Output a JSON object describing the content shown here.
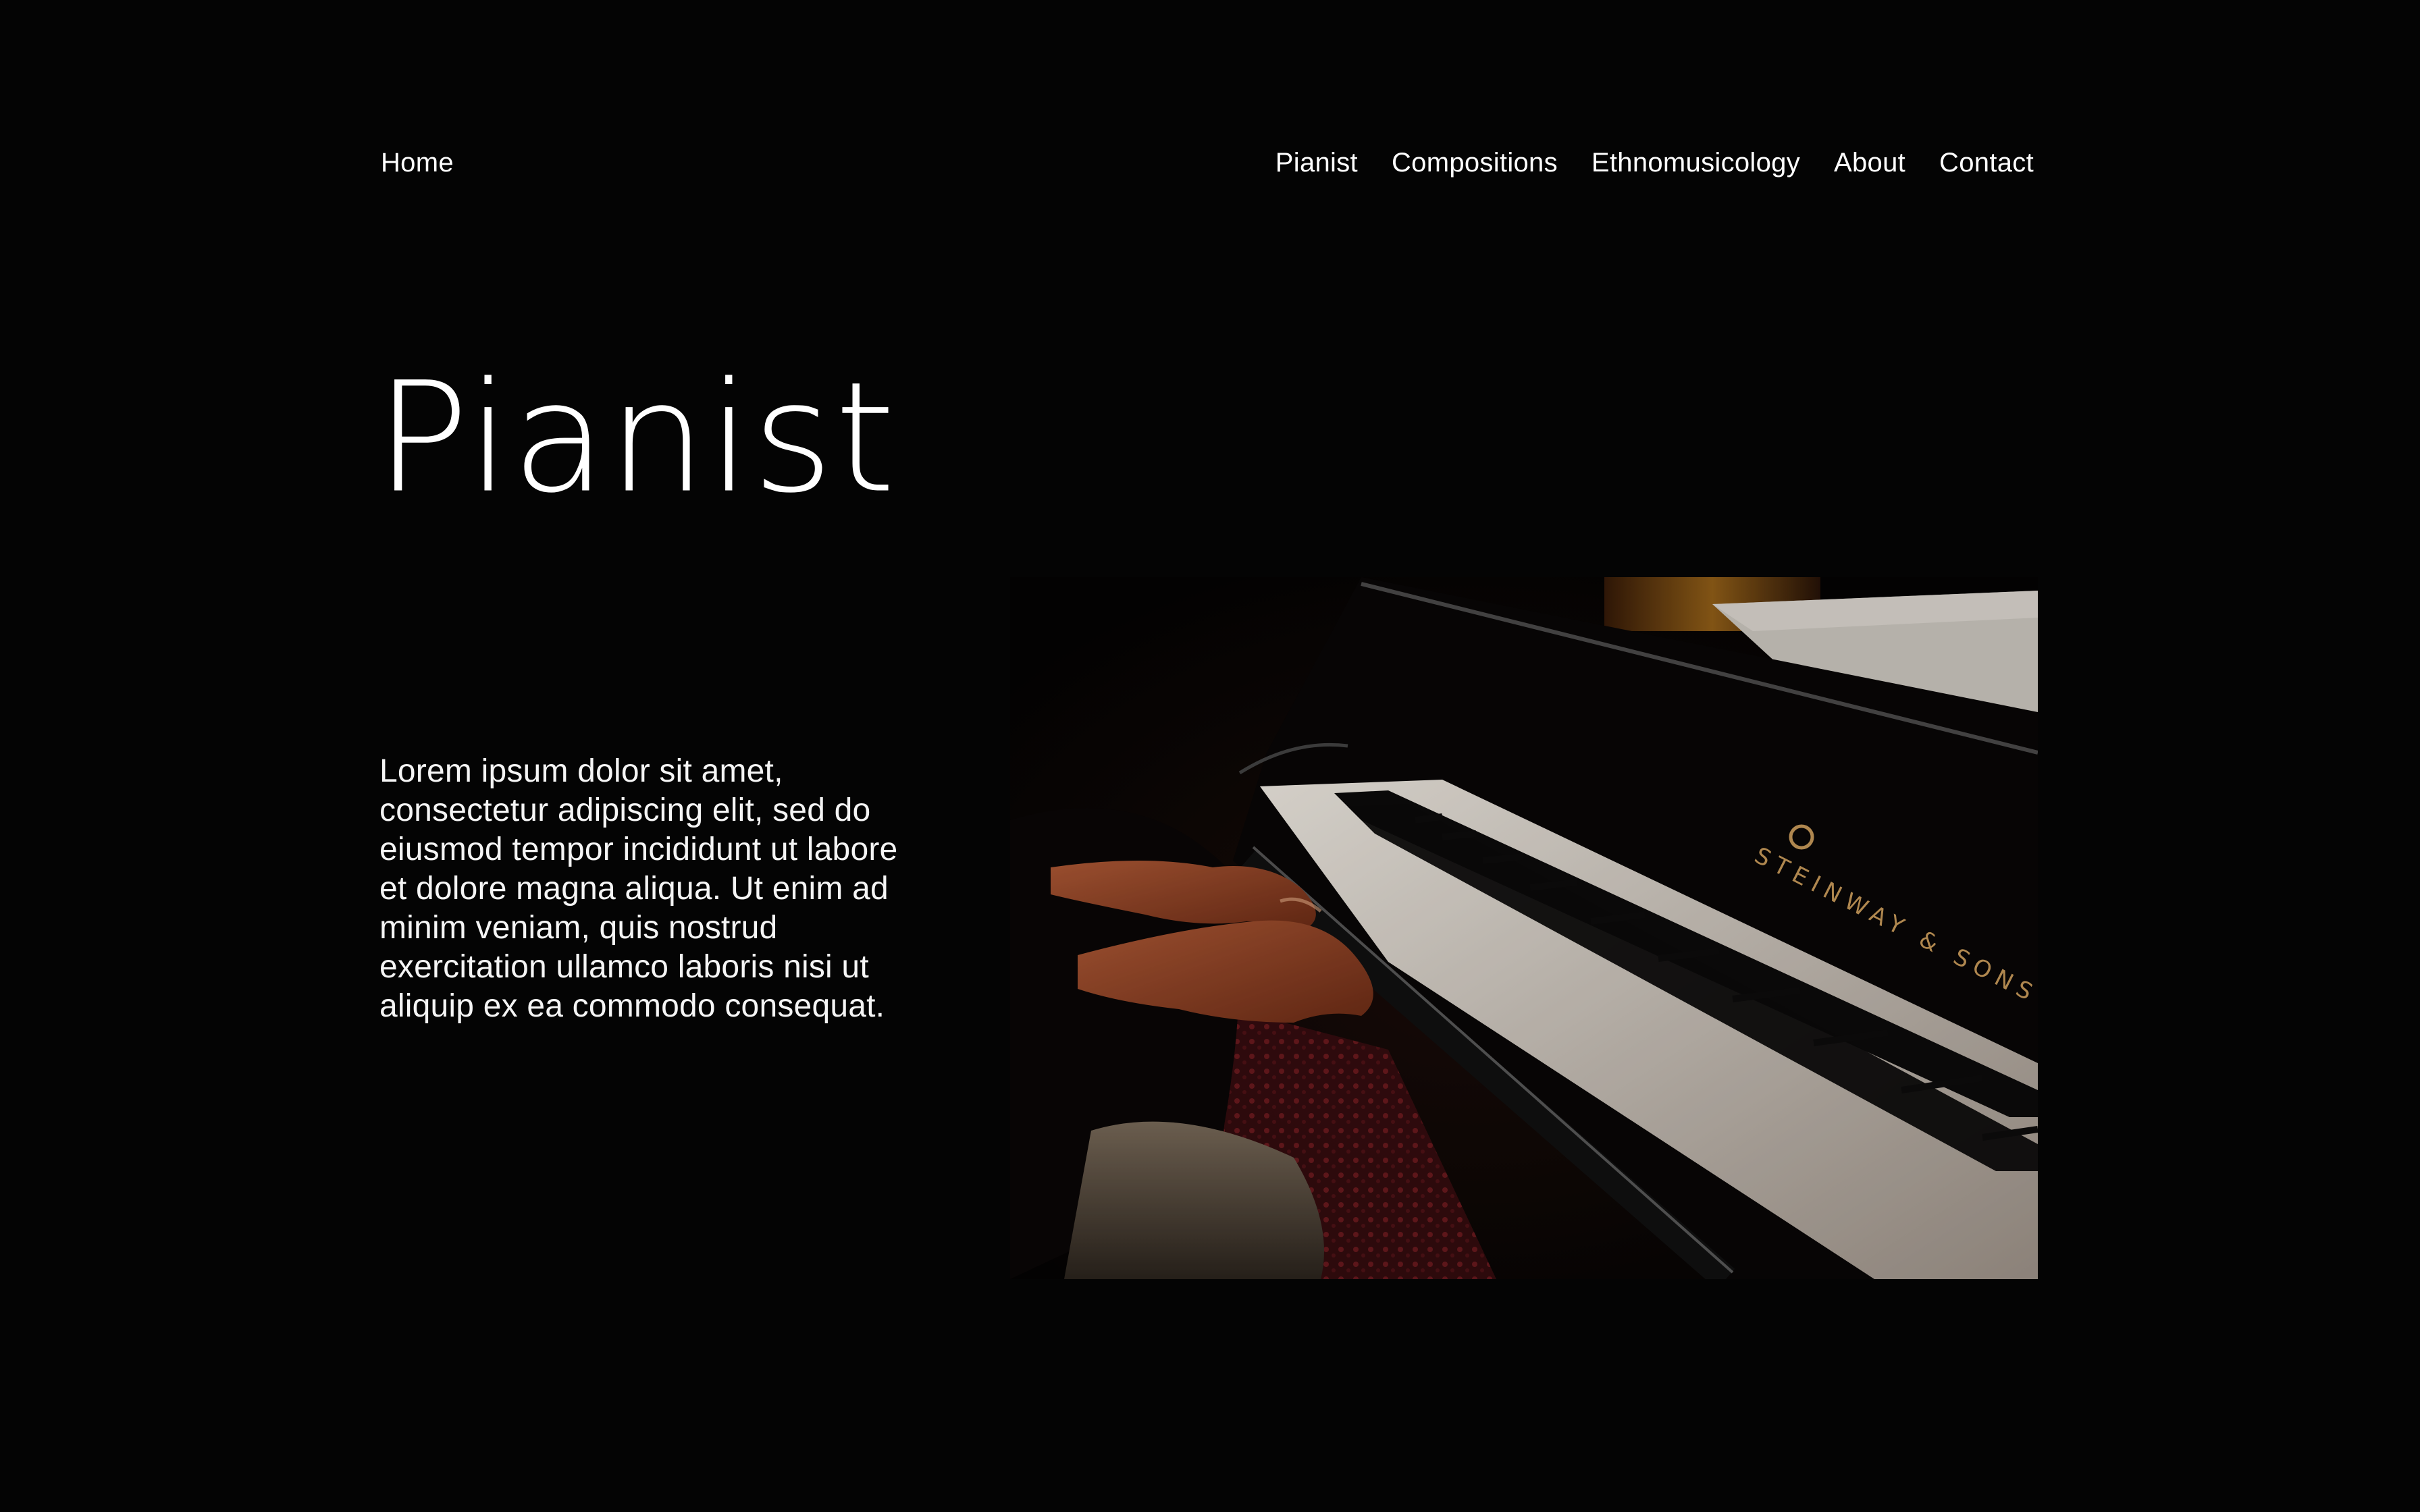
{
  "nav": {
    "home": "Home",
    "items": [
      "Pianist",
      "Compositions",
      "Ethnomusicology",
      "About",
      "Contact"
    ]
  },
  "hero": {
    "title": "Pianist",
    "body": "Lorem ipsum dolor sit amet, consectetur adipiscing elit, sed do eiusmod tempor incididunt ut labore et dolore magna aliqua. Ut enim ad minim veniam, quis nostrud exercitation ullamco laboris nisi ut aliquip ex ea commodo consequat."
  },
  "photo": {
    "brand": "STEINWAY & SONS"
  },
  "colors": {
    "background": "#040404",
    "text": "#ffffff",
    "brand_gold": "#c89a5a"
  }
}
